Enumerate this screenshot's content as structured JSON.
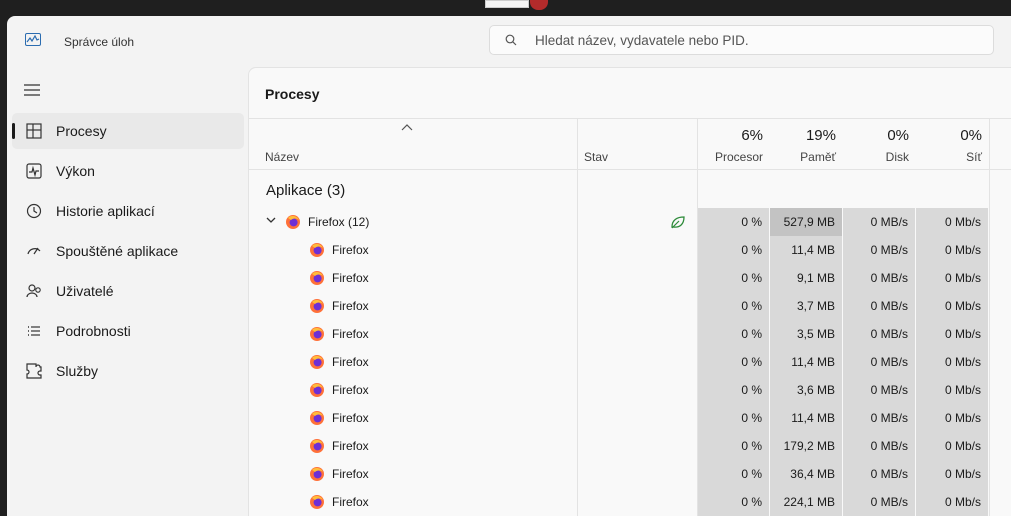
{
  "window": {
    "title": "Správce úloh",
    "search_placeholder": "Hledat název, vydavatele nebo PID."
  },
  "sidebar": {
    "items": [
      {
        "label": "Procesy",
        "icon": "processes-icon",
        "active": true
      },
      {
        "label": "Výkon",
        "icon": "performance-icon",
        "active": false
      },
      {
        "label": "Historie aplikací",
        "icon": "history-icon",
        "active": false
      },
      {
        "label": "Spouštěné aplikace",
        "icon": "startup-icon",
        "active": false
      },
      {
        "label": "Uživatelé",
        "icon": "users-icon",
        "active": false
      },
      {
        "label": "Podrobnosti",
        "icon": "details-icon",
        "active": false
      },
      {
        "label": "Služby",
        "icon": "services-icon",
        "active": false
      }
    ]
  },
  "page": {
    "title": "Procesy"
  },
  "table": {
    "name_header": "Název",
    "status_header": "Stav",
    "columns": [
      {
        "pct": "6%",
        "label": "Procesor"
      },
      {
        "pct": "19%",
        "label": "Paměť"
      },
      {
        "pct": "0%",
        "label": "Disk"
      },
      {
        "pct": "0%",
        "label": "Síť"
      }
    ],
    "group_title": "Aplikace (3)",
    "parent": {
      "name": "Firefox (12)",
      "cpu": "0 %",
      "mem": "527,9 MB",
      "disk": "0 MB/s",
      "net": "0 Mb/s"
    },
    "children": [
      {
        "name": "Firefox",
        "cpu": "0 %",
        "mem": "11,4 MB",
        "disk": "0 MB/s",
        "net": "0 Mb/s"
      },
      {
        "name": "Firefox",
        "cpu": "0 %",
        "mem": "9,1 MB",
        "disk": "0 MB/s",
        "net": "0 Mb/s"
      },
      {
        "name": "Firefox",
        "cpu": "0 %",
        "mem": "3,7 MB",
        "disk": "0 MB/s",
        "net": "0 Mb/s"
      },
      {
        "name": "Firefox",
        "cpu": "0 %",
        "mem": "3,5 MB",
        "disk": "0 MB/s",
        "net": "0 Mb/s"
      },
      {
        "name": "Firefox",
        "cpu": "0 %",
        "mem": "11,4 MB",
        "disk": "0 MB/s",
        "net": "0 Mb/s"
      },
      {
        "name": "Firefox",
        "cpu": "0 %",
        "mem": "3,6 MB",
        "disk": "0 MB/s",
        "net": "0 Mb/s"
      },
      {
        "name": "Firefox",
        "cpu": "0 %",
        "mem": "11,4 MB",
        "disk": "0 MB/s",
        "net": "0 Mb/s"
      },
      {
        "name": "Firefox",
        "cpu": "0 %",
        "mem": "179,2 MB",
        "disk": "0 MB/s",
        "net": "0 Mb/s"
      },
      {
        "name": "Firefox",
        "cpu": "0 %",
        "mem": "36,4 MB",
        "disk": "0 MB/s",
        "net": "0 Mb/s"
      },
      {
        "name": "Firefox",
        "cpu": "0 %",
        "mem": "224,1 MB",
        "disk": "0 MB/s",
        "net": "0 Mb/s"
      }
    ]
  },
  "colors": {
    "accent": "#1a1a1a",
    "heat_low": "#d9d9d9",
    "heat_high": "#c3c3c3",
    "eco": "#2e8b3a"
  }
}
